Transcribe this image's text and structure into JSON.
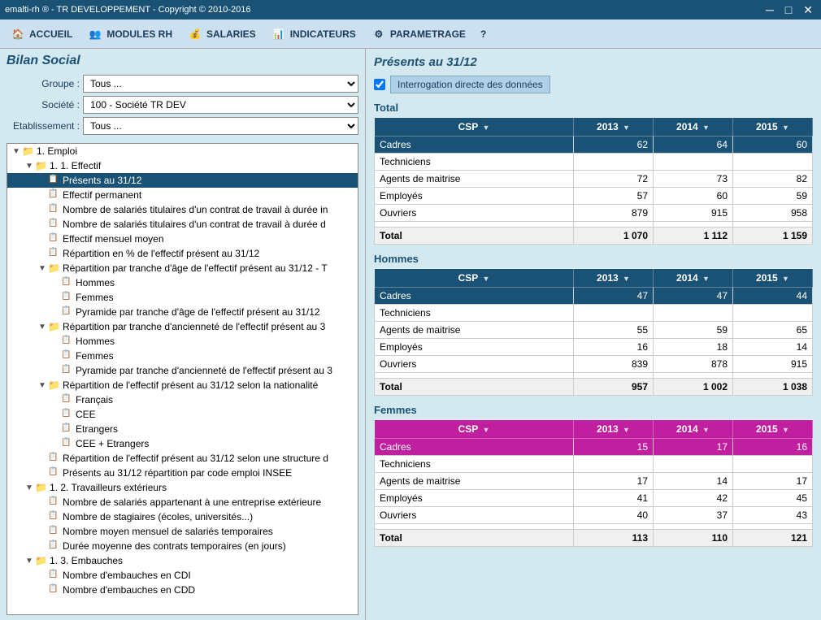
{
  "titleBar": {
    "title": "emalti-rh ® - TR DEVELOPPEMENT - Copyright © 2010-2016",
    "minimize": "─",
    "maximize": "□",
    "close": "✕"
  },
  "menuBar": {
    "items": [
      {
        "icon": "🏠",
        "label": "ACCUEIL"
      },
      {
        "icon": "👥",
        "label": "MODULES RH"
      },
      {
        "icon": "💰",
        "label": "SALARIES"
      },
      {
        "icon": "📊",
        "label": "INDICATEURS"
      },
      {
        "icon": "⚙",
        "label": "PARAMETRAGE"
      },
      {
        "icon": "?",
        "label": "?"
      }
    ]
  },
  "leftPanel": {
    "title": "Bilan Social",
    "form": {
      "groupe": {
        "label": "Groupe :",
        "value": "Tous ...",
        "options": [
          "Tous ..."
        ]
      },
      "societe": {
        "label": "Société :",
        "value": "100 - Société TR DEV",
        "options": [
          "100 - Société TR DEV"
        ]
      },
      "etablissement": {
        "label": "Etablissement :",
        "value": "Tous ...",
        "options": [
          "Tous ..."
        ]
      }
    },
    "tree": [
      {
        "id": 1,
        "level": 0,
        "type": "folder",
        "expanded": true,
        "label": "1. Emploi"
      },
      {
        "id": 2,
        "level": 1,
        "type": "folder",
        "expanded": true,
        "label": "1. 1. Effectif"
      },
      {
        "id": 3,
        "level": 2,
        "type": "leaf",
        "selected": true,
        "label": "Présents au 31/12"
      },
      {
        "id": 4,
        "level": 2,
        "type": "leaf",
        "label": "Effectif permanent"
      },
      {
        "id": 5,
        "level": 2,
        "type": "leaf",
        "label": "Nombre de salariés titulaires d'un contrat de travail à durée in"
      },
      {
        "id": 6,
        "level": 2,
        "type": "leaf",
        "label": "Nombre de salariés titulaires d'un contrat de travail à durée d"
      },
      {
        "id": 7,
        "level": 2,
        "type": "leaf",
        "label": "Effectif mensuel moyen"
      },
      {
        "id": 8,
        "level": 2,
        "type": "leaf",
        "label": "Répartition en % de l'effectif présent au 31/12"
      },
      {
        "id": 9,
        "level": 2,
        "type": "folder",
        "expanded": true,
        "label": "Répartition par tranche d'âge de l'effectif présent au 31/12 - T"
      },
      {
        "id": 10,
        "level": 3,
        "type": "leaf",
        "label": "Hommes"
      },
      {
        "id": 11,
        "level": 3,
        "type": "leaf",
        "label": "Femmes"
      },
      {
        "id": 12,
        "level": 3,
        "type": "leaf",
        "label": "Pyramide par tranche d'âge de l'effectif présent au 31/12"
      },
      {
        "id": 13,
        "level": 2,
        "type": "folder",
        "expanded": true,
        "label": "Répartition par tranche d'ancienneté de l'effectif présent au 3"
      },
      {
        "id": 14,
        "level": 3,
        "type": "leaf",
        "label": "Hommes"
      },
      {
        "id": 15,
        "level": 3,
        "type": "leaf",
        "label": "Femmes"
      },
      {
        "id": 16,
        "level": 3,
        "type": "leaf",
        "label": "Pyramide par tranche d'ancienneté de l'effectif présent au 3"
      },
      {
        "id": 17,
        "level": 2,
        "type": "folder",
        "expanded": true,
        "label": "Répartition de l'effectif présent au 31/12 selon la nationalité"
      },
      {
        "id": 18,
        "level": 3,
        "type": "leaf",
        "label": "Français"
      },
      {
        "id": 19,
        "level": 3,
        "type": "leaf",
        "label": "CEE"
      },
      {
        "id": 20,
        "level": 3,
        "type": "leaf",
        "label": "Etrangers"
      },
      {
        "id": 21,
        "level": 3,
        "type": "leaf",
        "label": "CEE + Etrangers"
      },
      {
        "id": 22,
        "level": 2,
        "type": "leaf",
        "label": "Répartition de l'effectif présent au 31/12 selon une structure d"
      },
      {
        "id": 23,
        "level": 2,
        "type": "leaf",
        "label": "Présents au 31/12 répartition par code emploi INSEE"
      },
      {
        "id": 24,
        "level": 1,
        "type": "folder",
        "expanded": true,
        "label": "1. 2. Travailleurs extérieurs"
      },
      {
        "id": 25,
        "level": 2,
        "type": "leaf",
        "label": "Nombre de salariés appartenant à une entreprise extérieure"
      },
      {
        "id": 26,
        "level": 2,
        "type": "leaf",
        "label": "Nombre de stagiaires (écoles, universités...)"
      },
      {
        "id": 27,
        "level": 2,
        "type": "leaf",
        "label": "Nombre moyen mensuel de salariés temporaires"
      },
      {
        "id": 28,
        "level": 2,
        "type": "leaf",
        "label": "Durée moyenne des contrats temporaires (en jours)"
      },
      {
        "id": 29,
        "level": 1,
        "type": "folder",
        "expanded": true,
        "label": "1. 3. Embauches"
      },
      {
        "id": 30,
        "level": 2,
        "type": "leaf",
        "label": "Nombre d'embauches en CDI"
      },
      {
        "id": 31,
        "level": 2,
        "type": "leaf",
        "label": "Nombre d'embauches en CDD"
      }
    ]
  },
  "rightPanel": {
    "title": "Présents au 31/12",
    "checkbox": {
      "checked": true,
      "label": "Interrogation directe des données"
    },
    "tables": {
      "total": {
        "title": "Total",
        "columns": [
          "CSP",
          "2013",
          "2014",
          "2015"
        ],
        "rows": [
          {
            "csp": "Cadres",
            "y2013": "62",
            "y2014": "64",
            "y2015": "60",
            "selected": true
          },
          {
            "csp": "Techniciens",
            "y2013": "",
            "y2014": "",
            "y2015": ""
          },
          {
            "csp": "Agents de maitrise",
            "y2013": "72",
            "y2014": "73",
            "y2015": "82"
          },
          {
            "csp": "Employés",
            "y2013": "57",
            "y2014": "60",
            "y2015": "59"
          },
          {
            "csp": "Ouvriers",
            "y2013": "879",
            "y2014": "915",
            "y2015": "958"
          },
          {
            "csp": "",
            "y2013": "",
            "y2014": "",
            "y2015": ""
          },
          {
            "csp": "Total",
            "y2013": "1 070",
            "y2014": "1 112",
            "y2015": "1 159",
            "total": true
          }
        ]
      },
      "hommes": {
        "title": "Hommes",
        "columns": [
          "CSP",
          "2013",
          "2014",
          "2015"
        ],
        "rows": [
          {
            "csp": "Cadres",
            "y2013": "47",
            "y2014": "47",
            "y2015": "44",
            "selected": true
          },
          {
            "csp": "Techniciens",
            "y2013": "",
            "y2014": "",
            "y2015": ""
          },
          {
            "csp": "Agents de maitrise",
            "y2013": "55",
            "y2014": "59",
            "y2015": "65"
          },
          {
            "csp": "Employés",
            "y2013": "16",
            "y2014": "18",
            "y2015": "14"
          },
          {
            "csp": "Ouvriers",
            "y2013": "839",
            "y2014": "878",
            "y2015": "915"
          },
          {
            "csp": "",
            "y2013": "",
            "y2014": "",
            "y2015": ""
          },
          {
            "csp": "Total",
            "y2013": "957",
            "y2014": "1 002",
            "y2015": "1 038",
            "total": true
          }
        ]
      },
      "femmes": {
        "title": "Femmes",
        "columns": [
          "CSP",
          "2013",
          "2014",
          "2015"
        ],
        "rows": [
          {
            "csp": "Cadres",
            "y2013": "15",
            "y2014": "17",
            "y2015": "16",
            "selected": true
          },
          {
            "csp": "Techniciens",
            "y2013": "",
            "y2014": "",
            "y2015": ""
          },
          {
            "csp": "Agents de maitrise",
            "y2013": "17",
            "y2014": "14",
            "y2015": "17"
          },
          {
            "csp": "Employés",
            "y2013": "41",
            "y2014": "42",
            "y2015": "45"
          },
          {
            "csp": "Ouvriers",
            "y2013": "40",
            "y2014": "37",
            "y2015": "43"
          },
          {
            "csp": "",
            "y2013": "",
            "y2014": "",
            "y2015": ""
          },
          {
            "csp": "Total",
            "y2013": "113",
            "y2014": "110",
            "y2015": "121",
            "total": true
          }
        ]
      }
    }
  }
}
